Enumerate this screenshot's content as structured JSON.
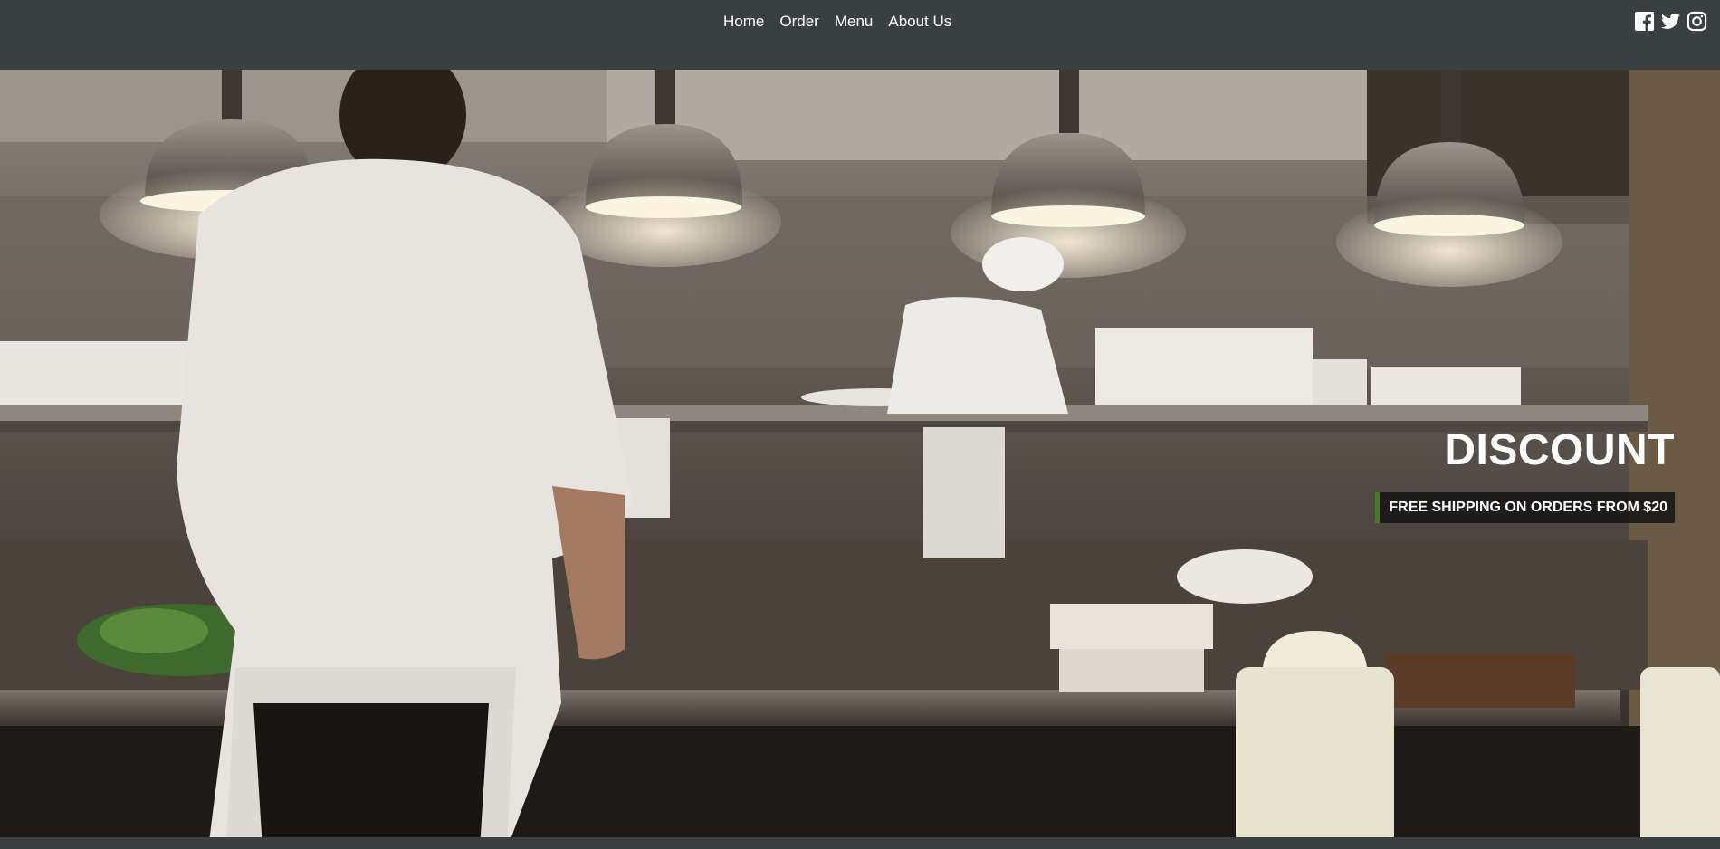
{
  "nav": {
    "items": [
      {
        "label": "Home"
      },
      {
        "label": "Order"
      },
      {
        "label": "Menu"
      },
      {
        "label": "About Us"
      }
    ]
  },
  "social": {
    "icons": [
      "facebook-icon",
      "twitter-icon",
      "instagram-icon"
    ]
  },
  "promo": {
    "title": "DISCOUNT",
    "subtitle": "FREE SHIPPING ON ORDERS FROM $20"
  },
  "colors": {
    "nav_bg": "#3a4042",
    "accent": "#4a7a2a",
    "text": "#ffffff"
  }
}
